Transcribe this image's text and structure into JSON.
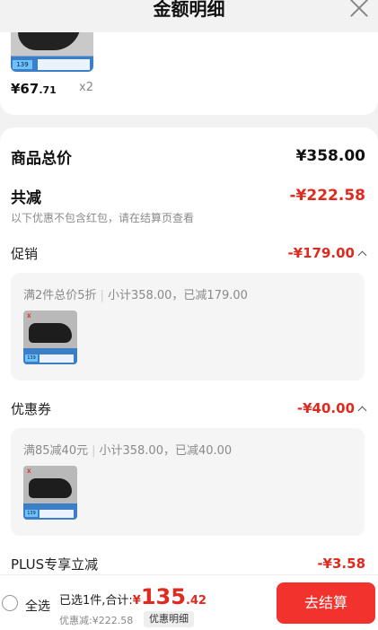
{
  "header": {
    "title": "金额明细"
  },
  "top_item": {
    "price_main": "¥67",
    "price_decimal": ".71",
    "quantity": "x2",
    "tag": "139"
  },
  "summary": {
    "total_label": "商品总价",
    "total_value": "¥358.00",
    "reduce_label": "共减",
    "reduce_value": "-¥222.58",
    "reduce_note": "以下优惠不包含红包，请在结算页查看"
  },
  "promo": {
    "label": "促销",
    "value": "-¥179.00",
    "rule": "满2件总价5折",
    "detail": "小计358.00，已减179.00",
    "thumb_tag": "139"
  },
  "coupon": {
    "label": "优惠券",
    "value": "-¥40.00",
    "rule": "满85减40元",
    "detail": "小计358.00，已减40.00",
    "thumb_tag": "139"
  },
  "plus": {
    "label": "PLUS专享立减",
    "value": "-¥3.58"
  },
  "footer": {
    "select_all": "全选",
    "selected_text": "已选1件,合计:",
    "currency": "¥",
    "total_int": "135",
    "total_dec": ".42",
    "discount_text": "优惠减:¥222.58",
    "detail_button": "优惠明细",
    "checkout_button": "去结算"
  },
  "colors": {
    "accent": "#f2322c",
    "price_red": "#e0291f"
  }
}
